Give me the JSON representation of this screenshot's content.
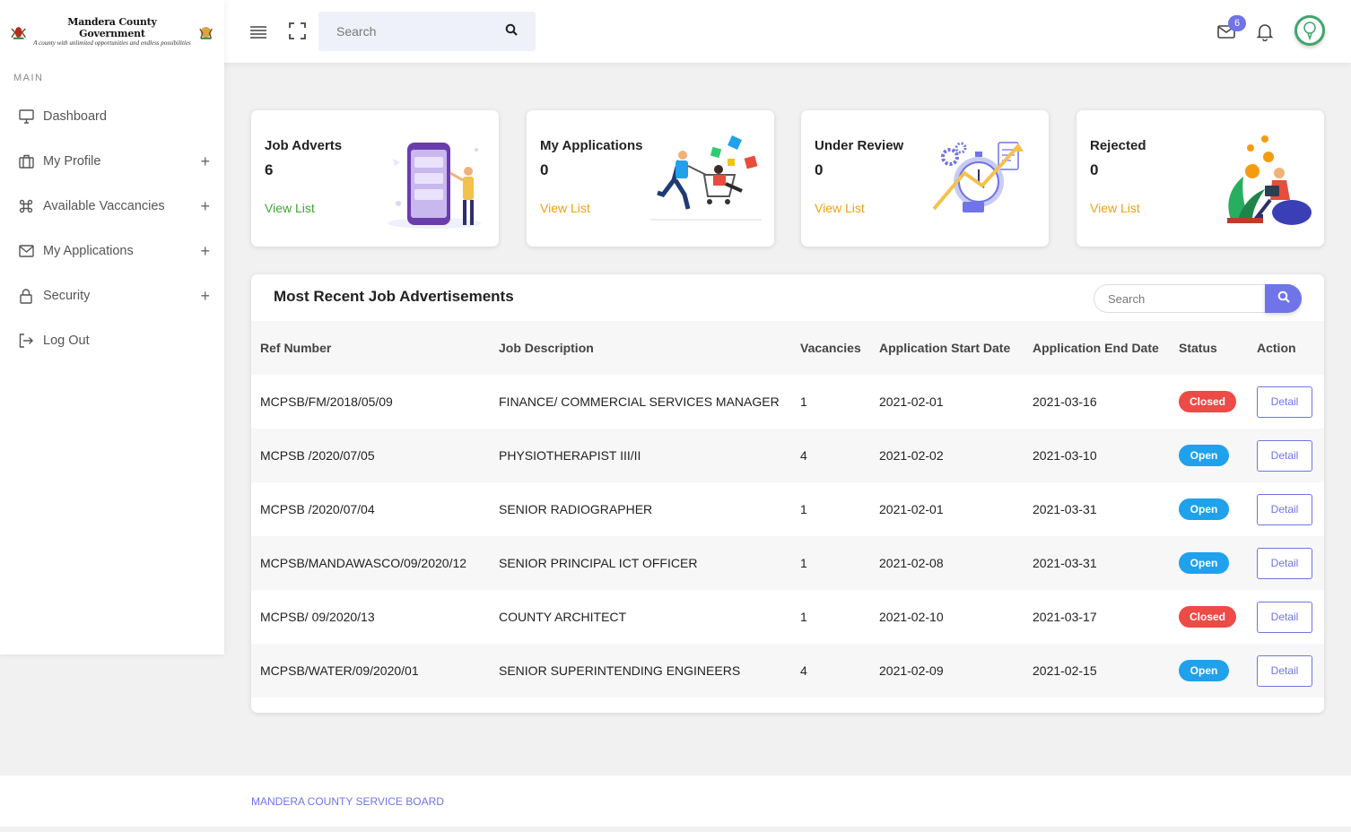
{
  "brand": {
    "name_part1": "Mandera ",
    "name_part2": "County Government",
    "tagline": "A county with unlimited opportunities and endless possibilities"
  },
  "sidebar": {
    "section": "MAIN",
    "items": [
      {
        "label": "Dashboard",
        "icon": "monitor-icon",
        "expandable": false
      },
      {
        "label": "My Profile",
        "icon": "briefcase-icon",
        "expandable": true
      },
      {
        "label": "Available Vaccancies",
        "icon": "command-icon",
        "expandable": true
      },
      {
        "label": "My Applications",
        "icon": "mail-icon",
        "expandable": true
      },
      {
        "label": "Security",
        "icon": "lock-icon",
        "expandable": true
      },
      {
        "label": "Log Out",
        "icon": "logout-icon",
        "expandable": false
      }
    ],
    "plus": "+"
  },
  "header": {
    "search_placeholder": "Search",
    "mail_badge": "6"
  },
  "cards": [
    {
      "title": "Job Adverts",
      "count": "6",
      "link": "View List",
      "link_color": "#3fa535"
    },
    {
      "title": "My Applications",
      "count": "0",
      "link": "View List",
      "link_color": "#f0a20c"
    },
    {
      "title": "Under Review",
      "count": "0",
      "link": "View List",
      "link_color": "#f0a20c"
    },
    {
      "title": "Rejected",
      "count": "0",
      "link": "View List",
      "link_color": "#f0a20c"
    }
  ],
  "table": {
    "title": "Most Recent Job Advertisements",
    "search_placeholder": "Search",
    "columns": [
      "Ref Number",
      "Job Description",
      "Vacancies",
      "Application Start Date",
      "Application End Date",
      "Status",
      "Action"
    ],
    "rows": [
      {
        "ref": "MCPSB/FM/2018/05/09",
        "desc": "FINANCE/ COMMERCIAL SERVICES MANAGER",
        "vac": "1",
        "start": "2021-02-01",
        "end": "2021-03-16",
        "status": "Closed",
        "action": "Detail"
      },
      {
        "ref": "MCPSB /2020/07/05",
        "desc": "PHYSIOTHERAPIST III/II",
        "vac": "4",
        "start": "2021-02-02",
        "end": "2021-03-10",
        "status": "Open",
        "action": "Detail"
      },
      {
        "ref": "MCPSB /2020/07/04",
        "desc": "SENIOR RADIOGRAPHER",
        "vac": "1",
        "start": "2021-02-01",
        "end": "2021-03-31",
        "status": "Open",
        "action": "Detail"
      },
      {
        "ref": "MCPSB/MANDAWASCO/09/2020/12",
        "desc": "SENIOR PRINCIPAL ICT OFFICER",
        "vac": "1",
        "start": "2021-02-08",
        "end": "2021-03-31",
        "status": "Open",
        "action": "Detail"
      },
      {
        "ref": "MCPSB/ 09/2020/13",
        "desc": "COUNTY ARCHITECT",
        "vac": "1",
        "start": "2021-02-10",
        "end": "2021-03-17",
        "status": "Closed",
        "action": "Detail"
      },
      {
        "ref": "MCPSB/WATER/09/2020/01",
        "desc": "SENIOR SUPERINTENDING ENGINEERS",
        "vac": "4",
        "start": "2021-02-09",
        "end": "2021-02-15",
        "status": "Open",
        "action": "Detail"
      }
    ]
  },
  "footer": {
    "text": "MANDERA COUNTY SERVICE BOARD"
  },
  "colors": {
    "accent": "#6f74e8",
    "closed": "#ee4a46",
    "open": "#1fa1ec"
  }
}
